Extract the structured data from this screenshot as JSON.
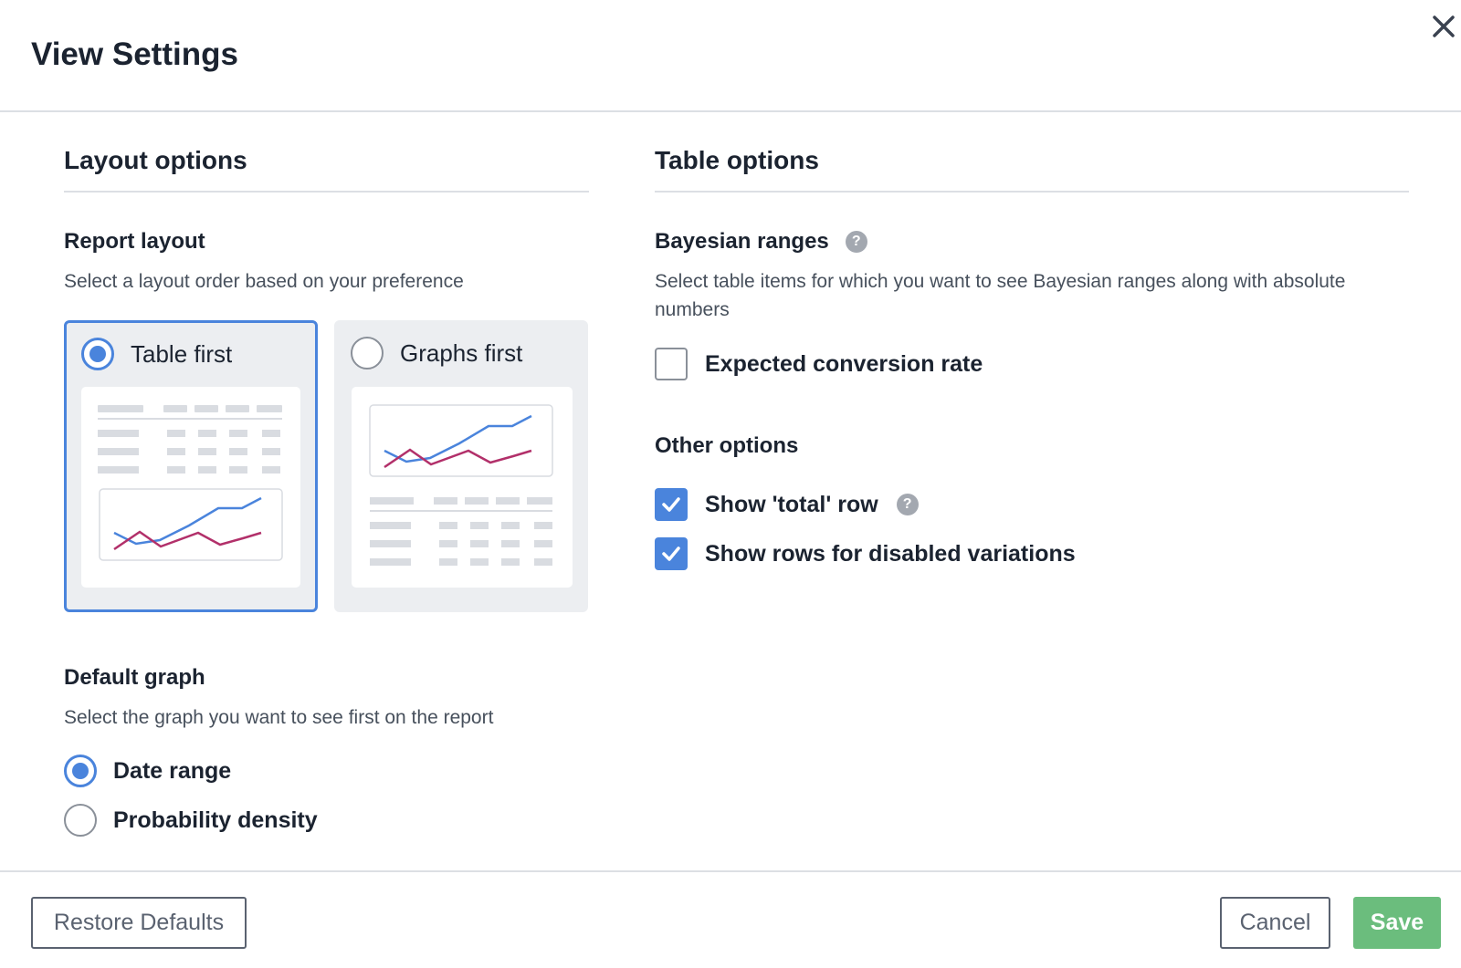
{
  "modal": {
    "title": "View Settings",
    "close_icon": "close-icon"
  },
  "layout_options": {
    "title": "Layout options",
    "report_layout": {
      "label": "Report layout",
      "description": "Select a layout order based on your preference",
      "options": [
        {
          "label": "Table first",
          "selected": true
        },
        {
          "label": "Graphs first",
          "selected": false
        }
      ]
    },
    "default_graph": {
      "label": "Default graph",
      "description": "Select the graph you want to see first on the report",
      "options": [
        {
          "label": "Date range",
          "selected": true
        },
        {
          "label": "Probability density",
          "selected": false
        }
      ]
    }
  },
  "table_options": {
    "title": "Table options",
    "bayesian": {
      "label": "Bayesian ranges",
      "description": "Select table items for which you want to see Bayesian ranges along with absolute numbers",
      "help_icon": "question-mark-icon",
      "options": [
        {
          "label": "Expected conversion rate",
          "checked": false
        }
      ]
    },
    "other": {
      "label": "Other options",
      "options": [
        {
          "label": "Show 'total' row",
          "checked": true,
          "help_icon": "question-mark-icon"
        },
        {
          "label": "Show rows for disabled variations",
          "checked": true
        }
      ]
    }
  },
  "footer": {
    "restore_label": "Restore Defaults",
    "cancel_label": "Cancel",
    "save_label": "Save"
  },
  "colors": {
    "accent": "#4a84dc",
    "save": "#6bbd7d",
    "series_a": "#4a84dc",
    "series_b": "#b2306a"
  }
}
